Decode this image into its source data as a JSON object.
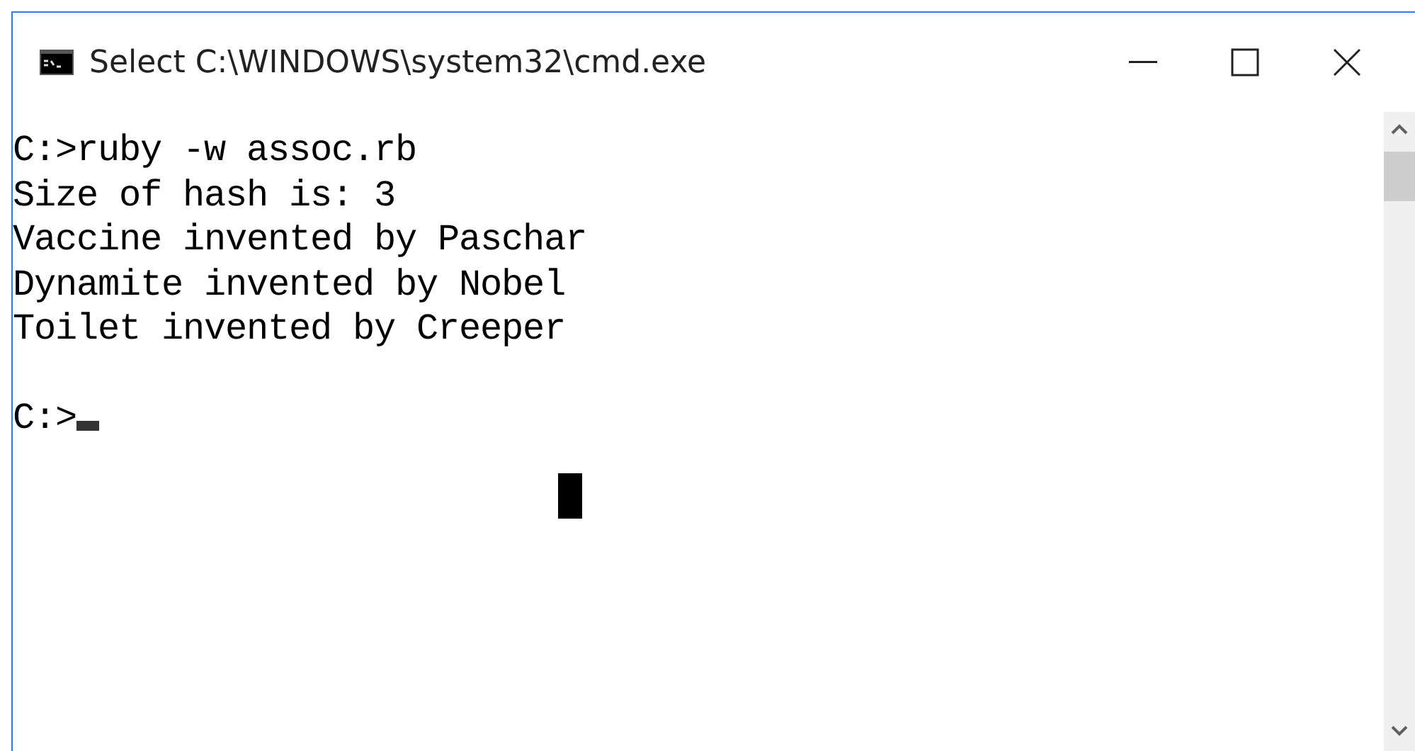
{
  "window": {
    "title": "Select C:\\WINDOWS\\system32\\cmd.exe"
  },
  "console": {
    "lines": [
      "C:>ruby -w assoc.rb",
      "Size of hash is: 3",
      "Vaccine invented by Paschar",
      "Dynamite invented by Nobel",
      "Toilet invented by Creeper"
    ],
    "prompt": "C:>"
  }
}
